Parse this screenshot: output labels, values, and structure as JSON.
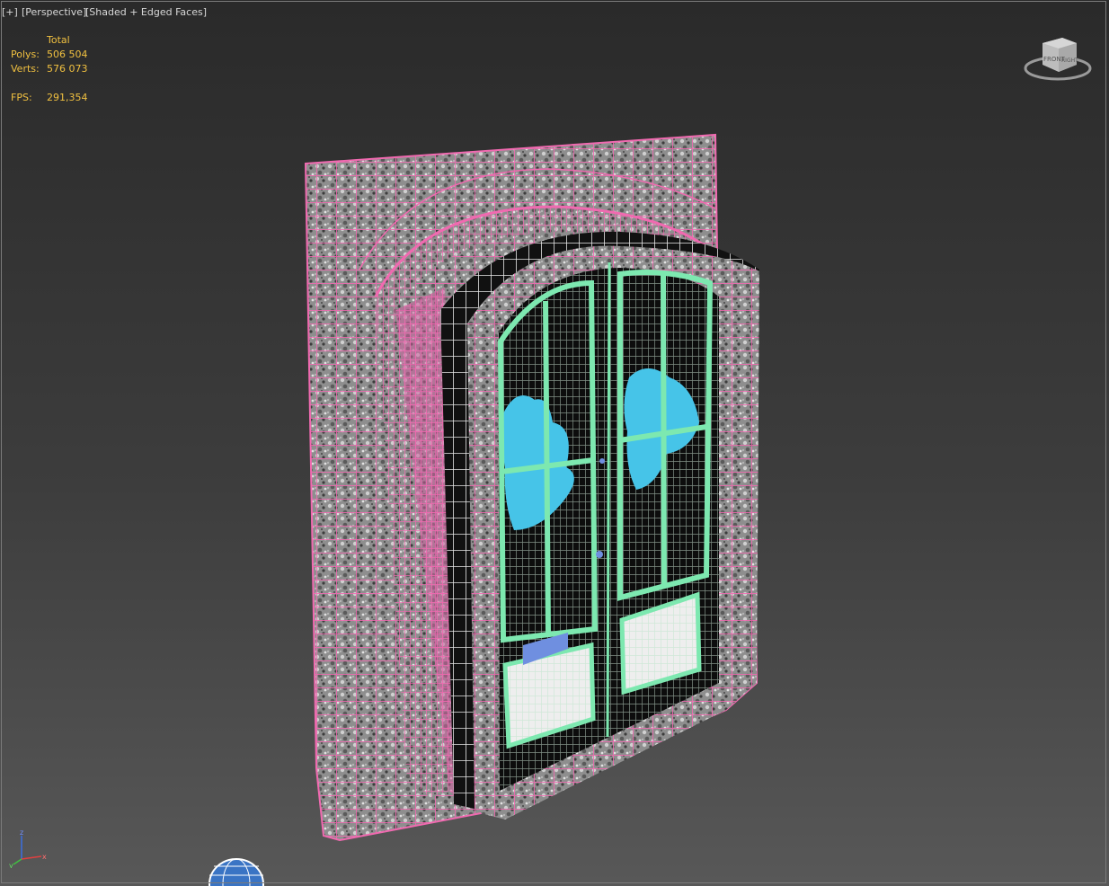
{
  "viewport": {
    "menu_plus": "[+]",
    "menu_view": "[Perspective]",
    "menu_shading": "[Shaded + Edged Faces]"
  },
  "stats": {
    "header": "Total",
    "polys_label": "Polys:",
    "polys_value": "506 504",
    "verts_label": "Verts:",
    "verts_value": "576 073",
    "fps_label": "FPS:",
    "fps_value": "291,354"
  },
  "viewcube": {
    "icon": "viewcube-icon",
    "face_front": "FRONT",
    "face_right": "RIGHT"
  },
  "axis_tripod": {
    "icon": "axis-tripod-icon",
    "z_label": "z",
    "x_label": "x",
    "y_label": "y"
  },
  "colors": {
    "stats_text": "#f0c040",
    "wire_pink": "#f06ab0",
    "wire_green": "#7de8b0",
    "glass_reflection": "#46c4e8"
  }
}
